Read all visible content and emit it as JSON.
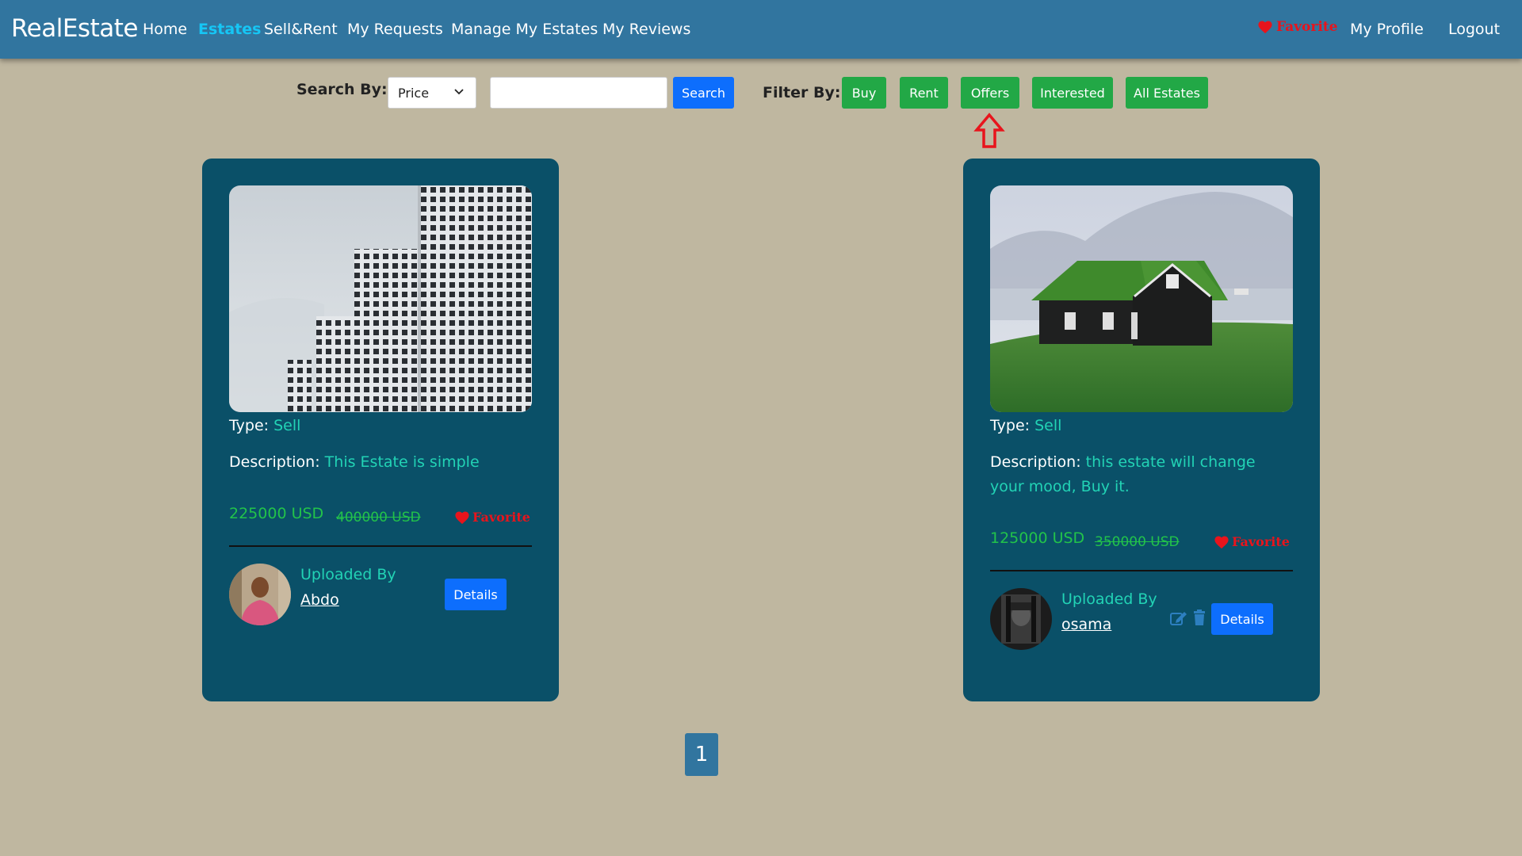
{
  "nav": {
    "brand": "RealEstate",
    "links": [
      {
        "label": "Home"
      },
      {
        "label": "Estates"
      },
      {
        "label": "Sell&Rent"
      },
      {
        "label": "My Requests"
      },
      {
        "label": "Manage My Estates"
      },
      {
        "label": "My Reviews"
      }
    ],
    "active_link": "Estates",
    "favorite_label": "Favorite",
    "profile_label": "My Profile",
    "logout_label": "Logout"
  },
  "search": {
    "label": "Search By:",
    "selected_option": "Price",
    "input_value": "",
    "button_label": "Search"
  },
  "filter": {
    "label": "Filter By:",
    "buttons": [
      "Buy",
      "Rent",
      "Offers",
      "Interested",
      "All Estates"
    ],
    "highlighted": "Offers"
  },
  "cards": [
    {
      "type_label": "Type:",
      "type_value": "Sell",
      "desc_label": "Description:",
      "desc_value": "This Estate is simple",
      "price": "225000 USD",
      "old_price": "400000 USD",
      "favorite_label": "Favorite",
      "uploaded_label": "Uploaded By",
      "uploader": "Abdo",
      "details_label": "Details"
    },
    {
      "type_label": "Type:",
      "type_value": "Sell",
      "desc_label": "Description:",
      "desc_value": "this estate will change your mood, Buy it.",
      "price": "125000 USD",
      "old_price": "350000 USD",
      "favorite_label": "Favorite",
      "uploaded_label": "Uploaded By",
      "uploader": "osama",
      "details_label": "Details"
    }
  ],
  "pagination": {
    "current_page": "1"
  },
  "colors": {
    "navbar": "#31759f",
    "active_link": "#16c6f5",
    "page_bg": "#bfb7a0",
    "card_bg": "#0a5068",
    "accent_teal": "#22d3b5",
    "price_green": "#22c34a",
    "favorite_red": "#e8141c",
    "button_green": "#22a846",
    "button_blue": "#0d6efd"
  },
  "icons": [
    "heart-icon",
    "chevron-down-icon",
    "arrow-up-icon",
    "edit-icon",
    "trash-icon"
  ]
}
